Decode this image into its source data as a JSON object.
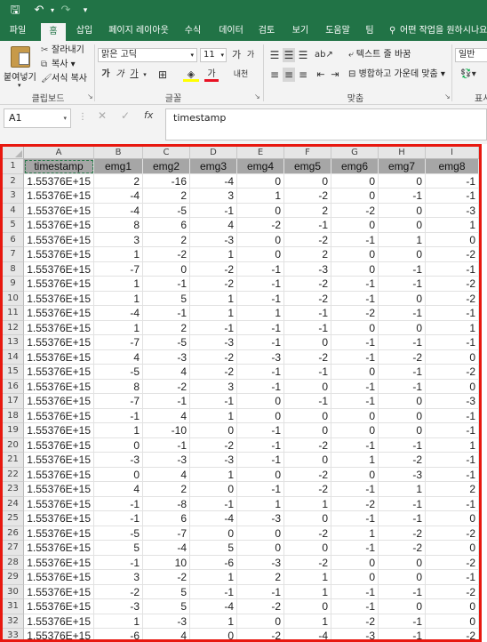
{
  "quick_access": {
    "save_icon": "save-icon",
    "undo_icon": "undo-icon",
    "redo_icon": "redo-icon"
  },
  "tabs": {
    "file": "파일",
    "home": "홈",
    "insert": "삽입",
    "layout": "페이지 레이아웃",
    "formulas": "수식",
    "data": "데이터",
    "review": "검토",
    "view": "보기",
    "help": "도움말",
    "team": "팀"
  },
  "tell_me": "어떤 작업을 원하시나요",
  "clipboard": {
    "paste": "붙여넣기",
    "cut": "잘라내기",
    "copy": "복사",
    "format_painter": "서식 복사",
    "group": "클립보드"
  },
  "font": {
    "name": "맑은 고딕",
    "size": "11",
    "bold": "가",
    "italic": "가",
    "underline": "가",
    "grow": "가",
    "shrink": "가",
    "phonetic": "내천",
    "group": "글꼴"
  },
  "alignment": {
    "wrap": "텍스트 줄 바꿈",
    "merge": "병합하고 가운데 맞춤",
    "group": "맞춤"
  },
  "number": {
    "format": "일반",
    "group": "표시"
  },
  "formula_bar": {
    "name_box": "A1",
    "fx": "fx",
    "content": "timestamp"
  },
  "sheet": {
    "columns": [
      "A",
      "B",
      "C",
      "D",
      "E",
      "F",
      "G",
      "H",
      "I"
    ],
    "header_row": [
      "timestamp",
      "emg1",
      "emg2",
      "emg3",
      "emg4",
      "emg5",
      "emg6",
      "emg7",
      "emg8"
    ],
    "rows": [
      [
        "1.55376E+15",
        "2",
        "-16",
        "-4",
        "0",
        "0",
        "0",
        "0",
        "-1"
      ],
      [
        "1.55376E+15",
        "-4",
        "2",
        "3",
        "1",
        "-2",
        "0",
        "-1",
        "-1"
      ],
      [
        "1.55376E+15",
        "-4",
        "-5",
        "-1",
        "0",
        "2",
        "-2",
        "0",
        "-3"
      ],
      [
        "1.55376E+15",
        "8",
        "6",
        "4",
        "-2",
        "-1",
        "0",
        "0",
        "1"
      ],
      [
        "1.55376E+15",
        "3",
        "2",
        "-3",
        "0",
        "-2",
        "-1",
        "1",
        "0"
      ],
      [
        "1.55376E+15",
        "1",
        "-2",
        "1",
        "0",
        "2",
        "0",
        "0",
        "-2"
      ],
      [
        "1.55376E+15",
        "-7",
        "0",
        "-2",
        "-1",
        "-3",
        "0",
        "-1",
        "-1"
      ],
      [
        "1.55376E+15",
        "1",
        "-1",
        "-2",
        "-1",
        "-2",
        "-1",
        "-1",
        "-2"
      ],
      [
        "1.55376E+15",
        "1",
        "5",
        "1",
        "-1",
        "-2",
        "-1",
        "0",
        "-2"
      ],
      [
        "1.55376E+15",
        "-4",
        "-1",
        "1",
        "1",
        "-1",
        "-2",
        "-1",
        "-1"
      ],
      [
        "1.55376E+15",
        "1",
        "2",
        "-1",
        "-1",
        "-1",
        "0",
        "0",
        "1"
      ],
      [
        "1.55376E+15",
        "-7",
        "-5",
        "-3",
        "-1",
        "0",
        "-1",
        "-1",
        "-1"
      ],
      [
        "1.55376E+15",
        "4",
        "-3",
        "-2",
        "-3",
        "-2",
        "-1",
        "-2",
        "0"
      ],
      [
        "1.55376E+15",
        "-5",
        "4",
        "-2",
        "-1",
        "-1",
        "0",
        "-1",
        "-2"
      ],
      [
        "1.55376E+15",
        "8",
        "-2",
        "3",
        "-1",
        "0",
        "-1",
        "-1",
        "0"
      ],
      [
        "1.55376E+15",
        "-7",
        "-1",
        "-1",
        "0",
        "-1",
        "-1",
        "0",
        "-3"
      ],
      [
        "1.55376E+15",
        "-1",
        "4",
        "1",
        "0",
        "0",
        "0",
        "0",
        "-1"
      ],
      [
        "1.55376E+15",
        "1",
        "-10",
        "0",
        "-1",
        "0",
        "0",
        "0",
        "-1"
      ],
      [
        "1.55376E+15",
        "0",
        "-1",
        "-2",
        "-1",
        "-2",
        "-1",
        "-1",
        "1"
      ],
      [
        "1.55376E+15",
        "-3",
        "-3",
        "-3",
        "-1",
        "0",
        "1",
        "-2",
        "-1"
      ],
      [
        "1.55376E+15",
        "0",
        "4",
        "1",
        "0",
        "-2",
        "0",
        "-3",
        "-1"
      ],
      [
        "1.55376E+15",
        "4",
        "2",
        "0",
        "-1",
        "-2",
        "-1",
        "1",
        "2"
      ],
      [
        "1.55376E+15",
        "-1",
        "-8",
        "-1",
        "1",
        "1",
        "-2",
        "-1",
        "-1"
      ],
      [
        "1.55376E+15",
        "-1",
        "6",
        "-4",
        "-3",
        "0",
        "-1",
        "-1",
        "0"
      ],
      [
        "1.55376E+15",
        "-5",
        "-7",
        "0",
        "0",
        "-2",
        "1",
        "-2",
        "-2"
      ],
      [
        "1.55376E+15",
        "5",
        "-4",
        "5",
        "0",
        "0",
        "-1",
        "-2",
        "0"
      ],
      [
        "1.55376E+15",
        "-1",
        "10",
        "-6",
        "-3",
        "-2",
        "0",
        "0",
        "-2"
      ],
      [
        "1.55376E+15",
        "3",
        "-2",
        "1",
        "2",
        "1",
        "0",
        "0",
        "-1"
      ],
      [
        "1.55376E+15",
        "-2",
        "5",
        "-1",
        "-1",
        "1",
        "-1",
        "-1",
        "-2"
      ],
      [
        "1.55376E+15",
        "-3",
        "5",
        "-4",
        "-2",
        "0",
        "-1",
        "0",
        "0"
      ],
      [
        "1.55376E+15",
        "1",
        "-3",
        "1",
        "0",
        "1",
        "-2",
        "-1",
        "0"
      ],
      [
        "1.55376E+15",
        "-6",
        "4",
        "0",
        "-2",
        "-4",
        "-3",
        "-1",
        "-2"
      ]
    ]
  }
}
